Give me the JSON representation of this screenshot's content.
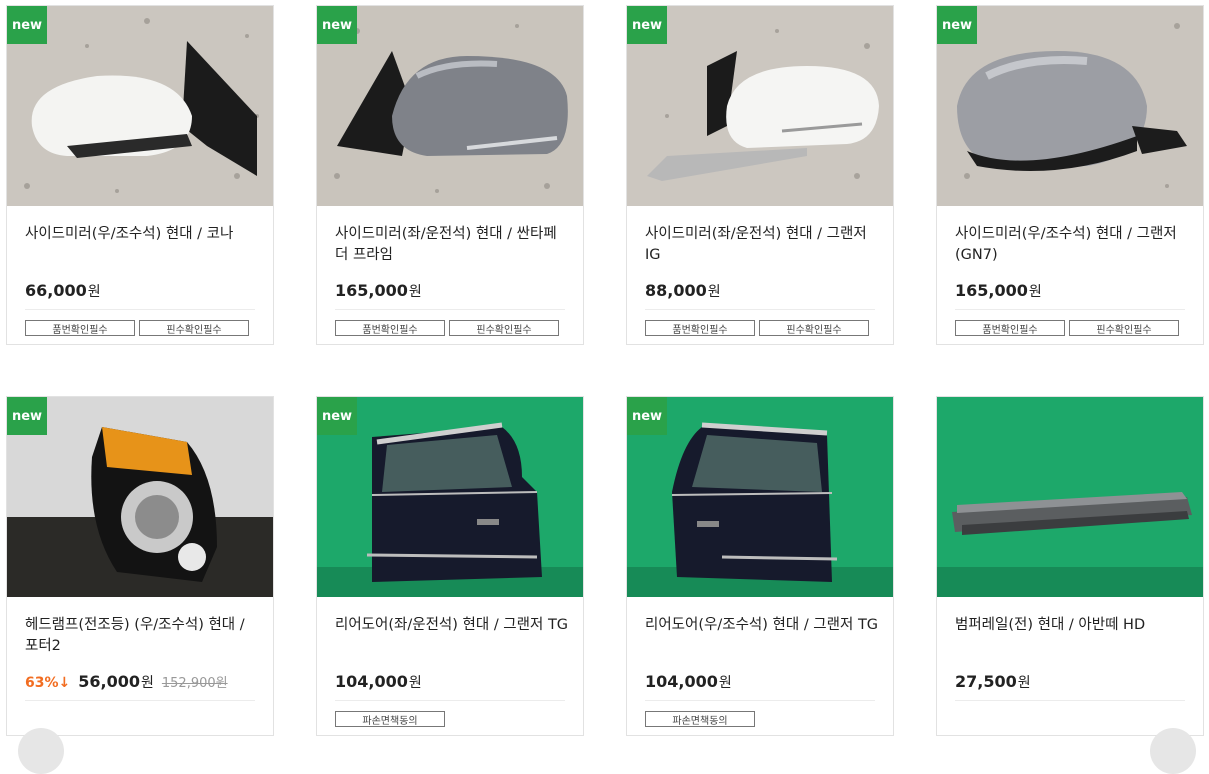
{
  "products": [
    {
      "badge": "new",
      "title": "사이드미러(우/조수석) 현대 / 코나",
      "price": "66,000",
      "currency": "원",
      "tags": [
        "품번확인필수",
        "핀수확인필수"
      ]
    },
    {
      "badge": "new",
      "title": "사이드미러(좌/운전석) 현대 / 싼타페 더 프라임",
      "price": "165,000",
      "currency": "원",
      "tags": [
        "품번확인필수",
        "핀수확인필수"
      ]
    },
    {
      "badge": "new",
      "title": "사이드미러(좌/운전석) 현대 / 그랜저 IG",
      "price": "88,000",
      "currency": "원",
      "tags": [
        "품번확인필수",
        "핀수확인필수"
      ]
    },
    {
      "badge": "new",
      "title": "사이드미러(우/조수석) 현대 / 그랜저 (GN7)",
      "price": "165,000",
      "currency": "원",
      "tags": [
        "품번확인필수",
        "핀수확인필수"
      ]
    },
    {
      "badge": "new",
      "title": "헤드램프(전조등) (우/조수석) 현대 / 포터2",
      "discount": "63%↓",
      "price": "56,000",
      "currency": "원",
      "original_price": "152,900원",
      "tags": []
    },
    {
      "badge": "new",
      "title": "리어도어(좌/운전석) 현대 / 그랜저 TG",
      "price": "104,000",
      "currency": "원",
      "tags": [
        "파손면책동의"
      ]
    },
    {
      "badge": "new",
      "title": "리어도어(우/조수석) 현대 / 그랜저 TG",
      "price": "104,000",
      "currency": "원",
      "tags": [
        "파손면책동의"
      ]
    },
    {
      "badge": "",
      "title": "범퍼레일(전) 현대 / 아반떼 HD",
      "price": "27,500",
      "currency": "원",
      "tags": []
    }
  ],
  "colors": {
    "badge": "#2aa24a",
    "discount": "#f26d21"
  }
}
